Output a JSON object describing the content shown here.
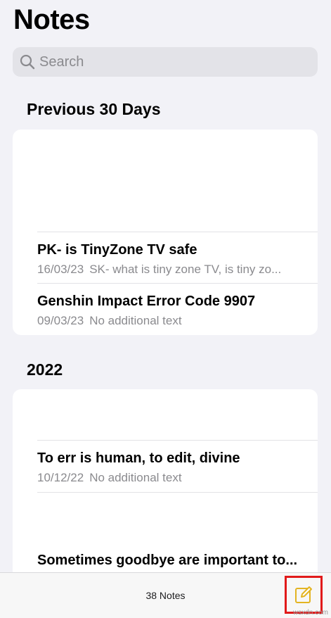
{
  "header": {
    "title": "Notes"
  },
  "search": {
    "placeholder": "Search"
  },
  "sections": [
    {
      "header": "Previous 30 Days",
      "notes": [
        {
          "title": "PK- is TinyZone TV safe",
          "date": "16/03/23",
          "preview": "SK- what is tiny zone TV, is tiny zo..."
        },
        {
          "title": "Genshin Impact Error Code 9907",
          "date": "09/03/23",
          "preview": "No additional text"
        }
      ]
    },
    {
      "header": "2022",
      "notes": [
        {
          "title": "To err is human, to edit, divine",
          "date": "10/12/22",
          "preview": "No additional text"
        },
        {
          "title": "Sometimes goodbye are important to..."
        }
      ]
    }
  ],
  "toolbar": {
    "count": "38 Notes"
  },
  "colors": {
    "accent": "#e3b422",
    "highlight": "#e11a1a",
    "background": "#f2f2f7"
  },
  "icons": {
    "search": "search-icon",
    "compose": "compose-icon"
  },
  "watermark": "wsxdn.com"
}
